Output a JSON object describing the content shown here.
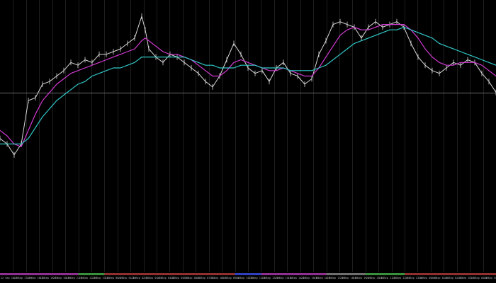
{
  "chart_data": {
    "type": "line",
    "title": "",
    "xlabel": "",
    "ylabel": "",
    "grid": true,
    "background_color": "#000000",
    "grid_color": "#1f1f1f",
    "price_line_color": "#c8c8c8",
    "reference_line_color": "#6a6a6a",
    "reference_level": 0.66,
    "ylim": [
      0,
      1
    ],
    "x": [
      0,
      10,
      20,
      30,
      40,
      50,
      60,
      70,
      80,
      90,
      100,
      110,
      120,
      130,
      140,
      150,
      160,
      170,
      180,
      190,
      200,
      205,
      210,
      220,
      230,
      240,
      250,
      260,
      270,
      280,
      290,
      300,
      310,
      320,
      330,
      340,
      350,
      360,
      370,
      380,
      390,
      400,
      410,
      420,
      430,
      440,
      450,
      460,
      470,
      480,
      490,
      500,
      510,
      520,
      530,
      540,
      550,
      560,
      570,
      580,
      590,
      600,
      610,
      620,
      630,
      640,
      650,
      660,
      670,
      680,
      690,
      700
    ],
    "series": [
      {
        "color": "#d8d8d8",
        "values": [
          0.49,
          0.47,
          0.43,
          0.47,
          0.63,
          0.64,
          0.69,
          0.7,
          0.72,
          0.74,
          0.77,
          0.76,
          0.78,
          0.77,
          0.8,
          0.8,
          0.81,
          0.82,
          0.84,
          0.86,
          0.94,
          0.89,
          0.82,
          0.79,
          0.77,
          0.8,
          0.79,
          0.77,
          0.75,
          0.73,
          0.7,
          0.68,
          0.72,
          0.78,
          0.84,
          0.8,
          0.75,
          0.73,
          0.74,
          0.7,
          0.75,
          0.77,
          0.73,
          0.72,
          0.69,
          0.71,
          0.8,
          0.85,
          0.91,
          0.92,
          0.91,
          0.9,
          0.86,
          0.9,
          0.92,
          0.9,
          0.91,
          0.92,
          0.9,
          0.84,
          0.79,
          0.76,
          0.74,
          0.73,
          0.75,
          0.77,
          0.76,
          0.78,
          0.77,
          0.73,
          0.7,
          0.66
        ]
      },
      {
        "color": "#d23ad2",
        "values": [
          0.52,
          0.5,
          0.47,
          0.46,
          0.52,
          0.58,
          0.63,
          0.66,
          0.69,
          0.71,
          0.73,
          0.74,
          0.75,
          0.76,
          0.77,
          0.78,
          0.79,
          0.8,
          0.81,
          0.82,
          0.85,
          0.86,
          0.85,
          0.83,
          0.81,
          0.8,
          0.8,
          0.79,
          0.78,
          0.76,
          0.74,
          0.72,
          0.72,
          0.74,
          0.77,
          0.78,
          0.77,
          0.76,
          0.75,
          0.74,
          0.74,
          0.75,
          0.74,
          0.73,
          0.72,
          0.72,
          0.75,
          0.79,
          0.83,
          0.87,
          0.89,
          0.9,
          0.89,
          0.89,
          0.9,
          0.91,
          0.91,
          0.91,
          0.91,
          0.89,
          0.86,
          0.82,
          0.79,
          0.77,
          0.76,
          0.76,
          0.77,
          0.77,
          0.77,
          0.76,
          0.74,
          0.72
        ]
      },
      {
        "color": "#33c8c8",
        "values": [
          0.47,
          0.47,
          0.47,
          0.47,
          0.49,
          0.53,
          0.57,
          0.6,
          0.63,
          0.65,
          0.67,
          0.69,
          0.7,
          0.72,
          0.73,
          0.74,
          0.75,
          0.75,
          0.76,
          0.77,
          0.79,
          0.79,
          0.79,
          0.79,
          0.79,
          0.79,
          0.79,
          0.79,
          0.78,
          0.77,
          0.76,
          0.76,
          0.75,
          0.75,
          0.75,
          0.76,
          0.76,
          0.76,
          0.75,
          0.75,
          0.75,
          0.75,
          0.74,
          0.74,
          0.74,
          0.74,
          0.75,
          0.76,
          0.78,
          0.8,
          0.82,
          0.84,
          0.85,
          0.86,
          0.87,
          0.88,
          0.89,
          0.89,
          0.9,
          0.89,
          0.88,
          0.87,
          0.86,
          0.84,
          0.83,
          0.82,
          0.81,
          0.8,
          0.79,
          0.78,
          0.77,
          0.76
        ]
      }
    ],
    "time_axis": {
      "labels": [
        "22 Sep 16:30",
        "22 Sep 17:00",
        "22 Sep 18:00",
        "22 Sep 19:00",
        "22 Sep 20:00",
        "22 Sep 21:00",
        "22 Sep 22:00",
        "22 Sep 23:00",
        "23 Sep 00:00",
        "23 Sep 01:00",
        "23 Sep 02:00",
        "23 Sep 03:00",
        "23 Sep 04:00",
        "23 Sep 05:00",
        "23 Sep 06:00",
        "23 Sep 07:00",
        "23 Sep 08:00",
        "23 Sep 09:00",
        "23 Sep 10:00",
        "23 Sep 11:00",
        "23 Sep 12:00",
        "23 Sep 13:00",
        "23 Sep 14:00",
        "23 Sep 15:00",
        "23 Sep 16:00",
        "23 Sep 17:00",
        "23 Sep 18:00",
        "23 Sep 19:00",
        "23 Sep 20:00",
        "23 Sep 21:00",
        "23 Sep 22:00",
        "23 Sep 23:00",
        "24 Sep 00:00",
        "24 Sep 01:00",
        "24 Sep 02:00",
        "24 Sep 03:00",
        "24 Sep 04:00",
        "24 Sep 05:00"
      ],
      "bar_colors": [
        "#8f2f8f",
        "#8f2f8f",
        "#8f2f8f",
        "#8f2f8f",
        "#8f2f8f",
        "#8f2f8f",
        "#3a8f3a",
        "#3a8f3a",
        "#8f2f2f",
        "#8f2f2f",
        "#8f2f2f",
        "#8f2f2f",
        "#8f2f2f",
        "#8f2f2f",
        "#8f2f2f",
        "#8f2f2f",
        "#8f2f2f",
        "#8f2f2f",
        "#2f3fbf",
        "#2f3fbf",
        "#8f2f8f",
        "#8f2f8f",
        "#8f2f8f",
        "#8f2f8f",
        "#8f2f8f",
        "#6f6f6f",
        "#6f6f6f",
        "#6f6f6f",
        "#3a8f3a",
        "#3a8f3a",
        "#3a8f3a",
        "#8f2f2f",
        "#8f2f2f",
        "#8f2f2f",
        "#8f2f2f",
        "#8f2f2f",
        "#8f2f2f",
        "#8f2f2f"
      ]
    }
  }
}
